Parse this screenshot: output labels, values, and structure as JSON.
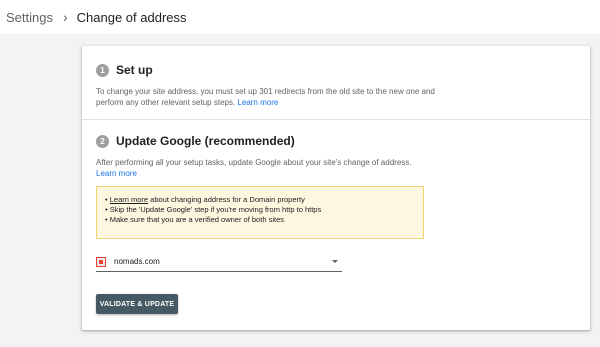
{
  "breadcrumb": {
    "root": "Settings",
    "separator": "›",
    "current": "Change of address"
  },
  "steps": [
    {
      "number": "1",
      "title": "Set up",
      "description": "To change your site address, you must set up 301 redirects from the old site to the new one and perform any other relevant setup steps.",
      "link": "Learn more"
    },
    {
      "number": "2",
      "title": "Update Google (recommended)",
      "description": "After performing all your setup tasks, update Google about your site's change of address.",
      "link": "Learn more"
    }
  ],
  "notice": {
    "bullet": "•",
    "item1_link": "Learn more",
    "item1_text": " about changing address for a Domain property",
    "item2_text": "Skip the 'Update Google' step if you're moving from http to https",
    "item3_text": "Make sure that you are a verified owner of both sites"
  },
  "property_select": {
    "icon": "domain-property-icon",
    "value": "nomads.com"
  },
  "validate_button": {
    "label": "VALIDATE & UPDATE"
  },
  "colors": {
    "accent_link": "#1a73e8",
    "button": "#455a64",
    "notice_bg": "#fef7e0"
  }
}
